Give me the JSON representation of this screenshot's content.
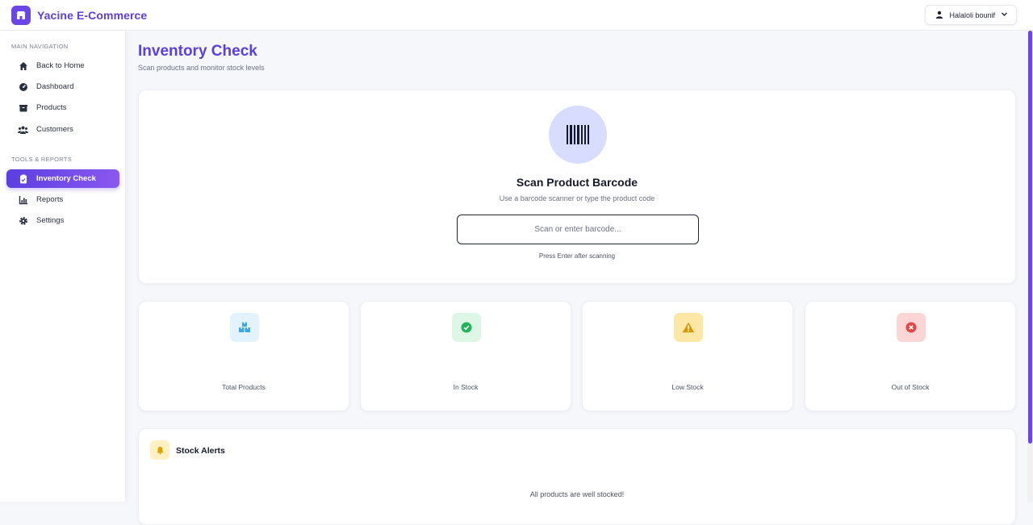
{
  "app": {
    "title": "Yacine E-Commerce"
  },
  "user": {
    "name": "Halaloli bounif"
  },
  "sidebar": {
    "sections": [
      {
        "title": "MAIN NAVIGATION",
        "items": [
          {
            "label": "Back to Home",
            "icon": "home-icon"
          },
          {
            "label": "Dashboard",
            "icon": "dashboard-icon"
          },
          {
            "label": "Products",
            "icon": "box-icon"
          },
          {
            "label": "Customers",
            "icon": "users-icon"
          }
        ]
      },
      {
        "title": "TOOLS & REPORTS",
        "items": [
          {
            "label": "Inventory Check",
            "icon": "clipboard-check-icon",
            "active": true
          },
          {
            "label": "Reports",
            "icon": "chart-icon"
          },
          {
            "label": "Settings",
            "icon": "gear-icon"
          }
        ]
      }
    ]
  },
  "page": {
    "title": "Inventory Check",
    "subtitle": "Scan products and monitor stock levels"
  },
  "scanner": {
    "title": "Scan Product Barcode",
    "subtitle": "Use a barcode scanner or type the product code",
    "placeholder": "Scan or enter barcode...",
    "hint": "Press Enter after scanning"
  },
  "stats": [
    {
      "label": "Total Products",
      "icon": "boxes-icon",
      "color": "#3aa9e0",
      "bg": "#e3f3fd"
    },
    {
      "label": "In Stock",
      "icon": "check-circle-icon",
      "color": "#22b45a",
      "bg": "#ddf6e6"
    },
    {
      "label": "Low Stock",
      "icon": "warning-icon",
      "color": "#d99a00",
      "bg": "#fde7a6"
    },
    {
      "label": "Out of Stock",
      "icon": "x-circle-icon",
      "color": "#e04848",
      "bg": "#fcd6d6"
    }
  ],
  "alerts": {
    "title": "Stock Alerts",
    "empty_message": "All products are well stocked!"
  },
  "colors": {
    "accent": "#5b3fe0"
  }
}
